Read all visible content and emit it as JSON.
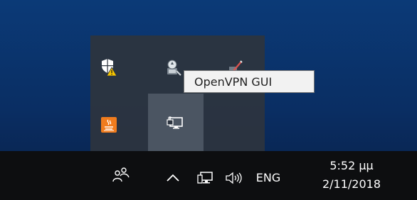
{
  "tooltip": {
    "text": "OpenVPN GUI"
  },
  "tray_overflow": {
    "icons": [
      "windows-security-warning-icon",
      "openvpn-connected-icon",
      "network-pen-icon",
      "java-app-icon",
      "network-lock-icon"
    ]
  },
  "taskbar": {
    "people_icon": "people-icon",
    "show_hidden_icon": "chevron-up-icon",
    "network_icon": "network-icon",
    "volume_icon": "volume-icon",
    "language": "ENG",
    "time": "5:52 μμ",
    "date": "2/11/2018"
  }
}
